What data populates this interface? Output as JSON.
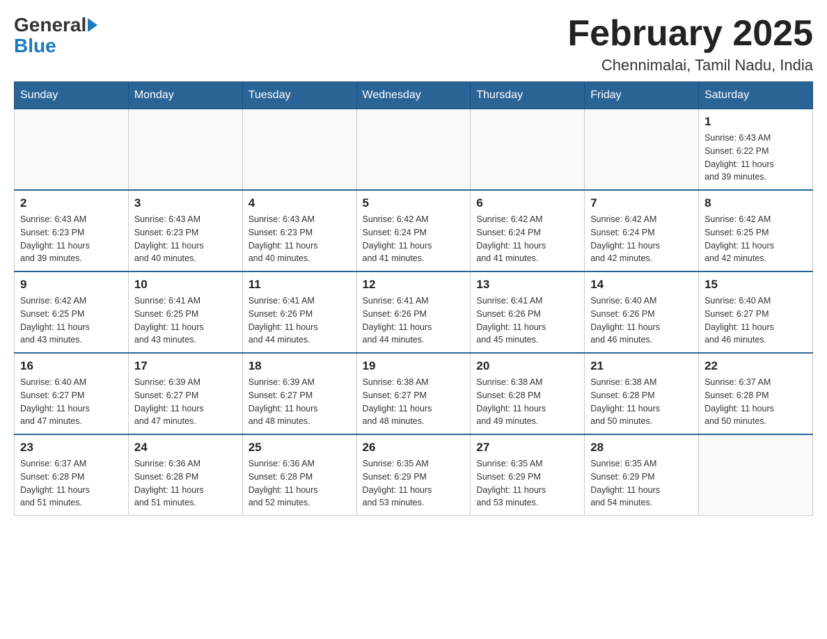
{
  "header": {
    "logo_general": "General",
    "logo_blue": "Blue",
    "month_title": "February 2025",
    "location": "Chennimalai, Tamil Nadu, India"
  },
  "days_of_week": [
    "Sunday",
    "Monday",
    "Tuesday",
    "Wednesday",
    "Thursday",
    "Friday",
    "Saturday"
  ],
  "weeks": [
    [
      {
        "day": "",
        "info": ""
      },
      {
        "day": "",
        "info": ""
      },
      {
        "day": "",
        "info": ""
      },
      {
        "day": "",
        "info": ""
      },
      {
        "day": "",
        "info": ""
      },
      {
        "day": "",
        "info": ""
      },
      {
        "day": "1",
        "info": "Sunrise: 6:43 AM\nSunset: 6:22 PM\nDaylight: 11 hours\nand 39 minutes."
      }
    ],
    [
      {
        "day": "2",
        "info": "Sunrise: 6:43 AM\nSunset: 6:23 PM\nDaylight: 11 hours\nand 39 minutes."
      },
      {
        "day": "3",
        "info": "Sunrise: 6:43 AM\nSunset: 6:23 PM\nDaylight: 11 hours\nand 40 minutes."
      },
      {
        "day": "4",
        "info": "Sunrise: 6:43 AM\nSunset: 6:23 PM\nDaylight: 11 hours\nand 40 minutes."
      },
      {
        "day": "5",
        "info": "Sunrise: 6:42 AM\nSunset: 6:24 PM\nDaylight: 11 hours\nand 41 minutes."
      },
      {
        "day": "6",
        "info": "Sunrise: 6:42 AM\nSunset: 6:24 PM\nDaylight: 11 hours\nand 41 minutes."
      },
      {
        "day": "7",
        "info": "Sunrise: 6:42 AM\nSunset: 6:24 PM\nDaylight: 11 hours\nand 42 minutes."
      },
      {
        "day": "8",
        "info": "Sunrise: 6:42 AM\nSunset: 6:25 PM\nDaylight: 11 hours\nand 42 minutes."
      }
    ],
    [
      {
        "day": "9",
        "info": "Sunrise: 6:42 AM\nSunset: 6:25 PM\nDaylight: 11 hours\nand 43 minutes."
      },
      {
        "day": "10",
        "info": "Sunrise: 6:41 AM\nSunset: 6:25 PM\nDaylight: 11 hours\nand 43 minutes."
      },
      {
        "day": "11",
        "info": "Sunrise: 6:41 AM\nSunset: 6:26 PM\nDaylight: 11 hours\nand 44 minutes."
      },
      {
        "day": "12",
        "info": "Sunrise: 6:41 AM\nSunset: 6:26 PM\nDaylight: 11 hours\nand 44 minutes."
      },
      {
        "day": "13",
        "info": "Sunrise: 6:41 AM\nSunset: 6:26 PM\nDaylight: 11 hours\nand 45 minutes."
      },
      {
        "day": "14",
        "info": "Sunrise: 6:40 AM\nSunset: 6:26 PM\nDaylight: 11 hours\nand 46 minutes."
      },
      {
        "day": "15",
        "info": "Sunrise: 6:40 AM\nSunset: 6:27 PM\nDaylight: 11 hours\nand 46 minutes."
      }
    ],
    [
      {
        "day": "16",
        "info": "Sunrise: 6:40 AM\nSunset: 6:27 PM\nDaylight: 11 hours\nand 47 minutes."
      },
      {
        "day": "17",
        "info": "Sunrise: 6:39 AM\nSunset: 6:27 PM\nDaylight: 11 hours\nand 47 minutes."
      },
      {
        "day": "18",
        "info": "Sunrise: 6:39 AM\nSunset: 6:27 PM\nDaylight: 11 hours\nand 48 minutes."
      },
      {
        "day": "19",
        "info": "Sunrise: 6:38 AM\nSunset: 6:27 PM\nDaylight: 11 hours\nand 48 minutes."
      },
      {
        "day": "20",
        "info": "Sunrise: 6:38 AM\nSunset: 6:28 PM\nDaylight: 11 hours\nand 49 minutes."
      },
      {
        "day": "21",
        "info": "Sunrise: 6:38 AM\nSunset: 6:28 PM\nDaylight: 11 hours\nand 50 minutes."
      },
      {
        "day": "22",
        "info": "Sunrise: 6:37 AM\nSunset: 6:28 PM\nDaylight: 11 hours\nand 50 minutes."
      }
    ],
    [
      {
        "day": "23",
        "info": "Sunrise: 6:37 AM\nSunset: 6:28 PM\nDaylight: 11 hours\nand 51 minutes."
      },
      {
        "day": "24",
        "info": "Sunrise: 6:36 AM\nSunset: 6:28 PM\nDaylight: 11 hours\nand 51 minutes."
      },
      {
        "day": "25",
        "info": "Sunrise: 6:36 AM\nSunset: 6:28 PM\nDaylight: 11 hours\nand 52 minutes."
      },
      {
        "day": "26",
        "info": "Sunrise: 6:35 AM\nSunset: 6:29 PM\nDaylight: 11 hours\nand 53 minutes."
      },
      {
        "day": "27",
        "info": "Sunrise: 6:35 AM\nSunset: 6:29 PM\nDaylight: 11 hours\nand 53 minutes."
      },
      {
        "day": "28",
        "info": "Sunrise: 6:35 AM\nSunset: 6:29 PM\nDaylight: 11 hours\nand 54 minutes."
      },
      {
        "day": "",
        "info": ""
      }
    ]
  ]
}
